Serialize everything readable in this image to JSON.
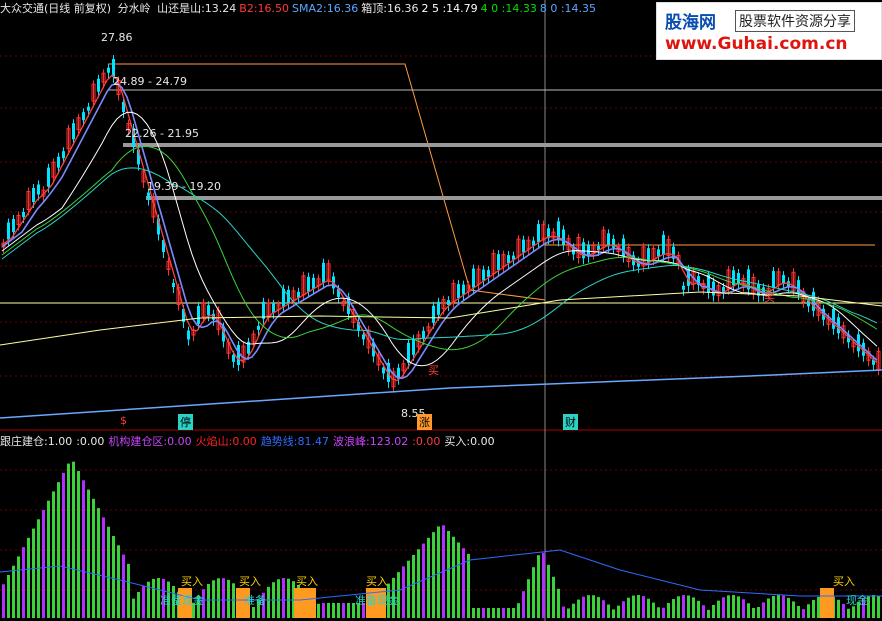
{
  "header": {
    "stock_title": "大众交通(日线 前复权)",
    "indicator_name": "分水岭",
    "items": [
      {
        "label": "山还是山:",
        "value": "13.24",
        "color": "#e8e8e8"
      },
      {
        "label": "B2:",
        "value": "16.50",
        "color": "#ff3b3b"
      },
      {
        "label": "SMA2:",
        "value": "16.36",
        "color": "#5aa8ff"
      },
      {
        "label": "箱顶:",
        "value": "16.36",
        "color": "#e8e8e8"
      },
      {
        "label": "2 5 :",
        "value": "14.79",
        "color": "#ffffff"
      },
      {
        "label": "4 0 :",
        "value": "14.33",
        "color": "#00e000"
      },
      {
        "label": "8 0 :",
        "value": "14.35",
        "color": "#5aa8ff"
      }
    ]
  },
  "price_labels": {
    "high": "27.86",
    "box1": "24.89 - 24.79",
    "box2": "22.26 - 21.95",
    "box3": "19.39 - 19.20",
    "low": "8.55"
  },
  "chart_markers": {
    "dollar": "$",
    "stop": "停",
    "up": "涨",
    "wealth": "财",
    "buy_cn": "买",
    "buy_small": "买"
  },
  "indicator_header": {
    "items": [
      {
        "label": "跟庄建仓:",
        "value": "1.00",
        "color": "#e8e8e8"
      },
      {
        "label": ":",
        "value": "0.00",
        "color": "#e8e8e8"
      },
      {
        "label": "机构建仓区:",
        "value": "0.00",
        "color": "#cc44ff"
      },
      {
        "label": "火焰山:",
        "value": "0.00",
        "color": "#ff2020"
      },
      {
        "label": "趋势线:",
        "value": "81.47",
        "color": "#2f6bff"
      },
      {
        "label": "波浪峰:",
        "value": "123.02",
        "color": "#cc44ff"
      },
      {
        "label": ":",
        "value": "0.00",
        "color": "#ff3b3b"
      },
      {
        "label": "买入:",
        "value": "0.00",
        "color": "#e8e8e8"
      }
    ]
  },
  "indicator_labels": {
    "buy": "买入",
    "prepare": "准备",
    "cash": "现金",
    "prepare_cash": "准备现金"
  },
  "watermark": {
    "brand_cn": "股海网",
    "slogan": "股票软件资源分享",
    "url": "www.Guhai.com.cn"
  },
  "colors": {
    "background": "#000000",
    "grid_red": "#7a0000",
    "up_candle": "#ff3030",
    "down_candle": "#00ffff",
    "bar_green": "#3ad43a",
    "bar_magenta": "#b030ff"
  }
}
